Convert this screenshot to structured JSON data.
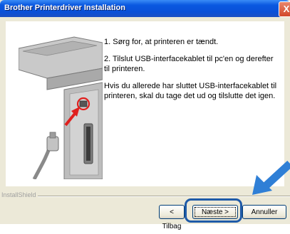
{
  "window": {
    "title": "Brother Printerdriver Installation",
    "close_label": "X"
  },
  "instructions": {
    "step1": "1. Sørg for, at printeren er tændt.",
    "step2": "2. Tilslut USB-interfacekablet til pc'en og derefter til printeren.",
    "step3": "Hvis du allerede har sluttet USB-interfacekablet til printeren, skal du tage det ud og tilslutte det igen."
  },
  "footer": {
    "group_label": "InstallShield"
  },
  "buttons": {
    "back_label": "< Tilbag",
    "next_label": "Næste >",
    "cancel_label": "Annuller"
  },
  "colors": {
    "titlebar": "#0a58e0",
    "highlight": "#1e5aa8",
    "arrow": "#2f7fd6"
  },
  "icons": {
    "close": "close-icon",
    "arrow": "pointer-arrow-icon"
  }
}
